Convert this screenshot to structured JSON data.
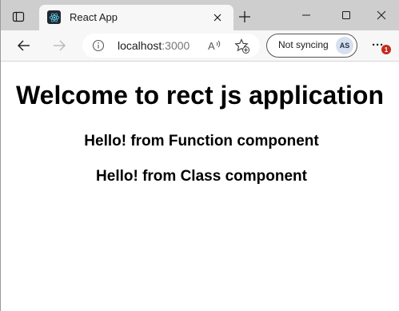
{
  "browser": {
    "tab": {
      "title": "React App",
      "favicon": "react-logo-icon"
    },
    "address_bar": {
      "host": "localhost",
      "port": ":3000"
    },
    "profile": {
      "sync_label": "Not syncing",
      "initials": "AS"
    },
    "menu": {
      "badge_count": "1"
    },
    "colors": {
      "tabstrip": "#cecece",
      "toolbar": "#f7f7f7",
      "badge": "#c42b1c",
      "avatar": "#d6e0ee"
    },
    "icons": {
      "tab_actions": "tab-actions-icon",
      "close": "close-icon",
      "new_tab": "plus-icon",
      "minimize": "minimize-icon",
      "maximize": "maximize-icon",
      "window_close": "close-icon",
      "back": "arrow-left-icon",
      "forward": "arrow-right-icon",
      "info": "info-icon",
      "read_aloud": "read-aloud-icon",
      "favorites": "add-favorite-icon",
      "menu": "more-icon"
    }
  },
  "page": {
    "heading": "Welcome to rect js application",
    "function_message": "Hello! from Function component",
    "class_message": "Hello! from Class component"
  }
}
